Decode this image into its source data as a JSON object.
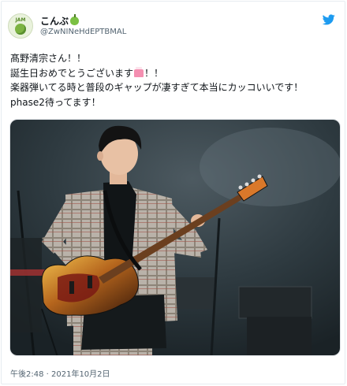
{
  "author": {
    "display_name": "こんぶ",
    "handle": "@ZwNINeHdEPTBMAL",
    "avatar_label": "JAM"
  },
  "tweet": {
    "line1": "髙野清宗さん！！",
    "line2_before": "誕生日おめでとうございます",
    "line2_after": "！！",
    "line3": "楽器弾いてる時と普段のギャップが凄すぎて本当にカッコいいです！",
    "line4": "phase2待ってます！"
  },
  "timestamp": "午後2:48 · 2021年10月2日",
  "icons": {
    "brand": "twitter-bird-icon",
    "emoji_name": "green-apple-icon",
    "emoji_text": "birthday-cake-icon"
  },
  "colors": {
    "text": "#0f1419",
    "secondary": "#536471",
    "twitter_blue": "#1d9bf0",
    "stage_background": "#2b3a42"
  }
}
